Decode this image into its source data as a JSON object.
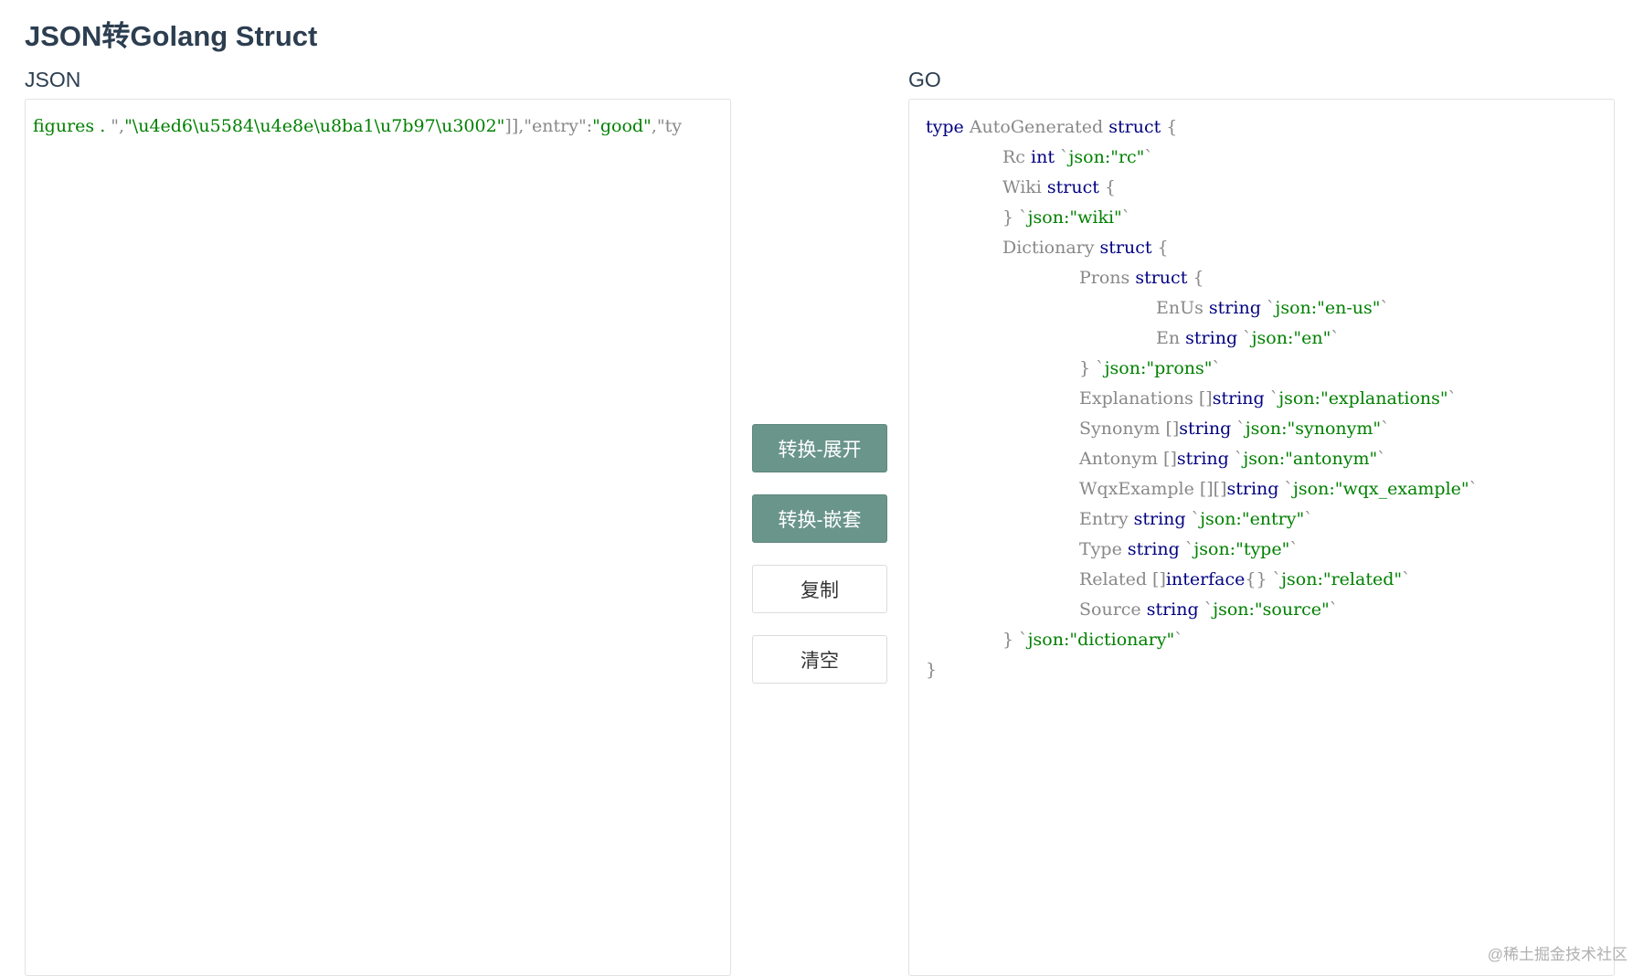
{
  "title": "JSON转Golang Struct",
  "json_label": "JSON",
  "go_label": "GO",
  "json_input": {
    "segments": [
      {
        "text": "figures . ",
        "kind": "str"
      },
      {
        "text": "\",",
        "kind": "p"
      },
      {
        "text": "\"\\u4ed6\\u5584\\u4e8e\\u8ba1\\u7b97\\u3002\"",
        "kind": "str"
      },
      {
        "text": "]],\"entry\":",
        "kind": "p"
      },
      {
        "text": "\"good\"",
        "kind": "str"
      },
      {
        "text": ",\"ty",
        "kind": "p"
      }
    ]
  },
  "buttons": {
    "convert_expand": "转换-展开",
    "convert_nested": "转换-嵌套",
    "copy": "复制",
    "clear": "清空"
  },
  "go_output": [
    {
      "indent": 0,
      "parts": [
        [
          "kw",
          "type"
        ],
        [
          "p",
          " AutoGenerated "
        ],
        [
          "kw",
          "struct"
        ],
        [
          "p",
          " {"
        ]
      ]
    },
    {
      "indent": 1,
      "parts": [
        [
          "p",
          "Rc "
        ],
        [
          "kw",
          "int"
        ],
        [
          "p",
          " `"
        ],
        [
          "str",
          "json:\"rc\""
        ],
        [
          "p",
          "`"
        ]
      ]
    },
    {
      "indent": 1,
      "parts": [
        [
          "p",
          "Wiki "
        ],
        [
          "kw",
          "struct"
        ],
        [
          "p",
          " {"
        ]
      ]
    },
    {
      "indent": 1,
      "parts": [
        [
          "p",
          "} `"
        ],
        [
          "str",
          "json:\"wiki\""
        ],
        [
          "p",
          "`"
        ]
      ]
    },
    {
      "indent": 1,
      "parts": [
        [
          "p",
          "Dictionary "
        ],
        [
          "kw",
          "struct"
        ],
        [
          "p",
          " {"
        ]
      ]
    },
    {
      "indent": 2,
      "parts": [
        [
          "p",
          "Prons "
        ],
        [
          "kw",
          "struct"
        ],
        [
          "p",
          " {"
        ]
      ]
    },
    {
      "indent": 3,
      "parts": [
        [
          "p",
          "EnUs "
        ],
        [
          "kw",
          "string"
        ],
        [
          "p",
          " `"
        ],
        [
          "str",
          "json:\"en-us\""
        ],
        [
          "p",
          "`"
        ]
      ]
    },
    {
      "indent": 3,
      "parts": [
        [
          "p",
          "En "
        ],
        [
          "kw",
          "string"
        ],
        [
          "p",
          " `"
        ],
        [
          "str",
          "json:\"en\""
        ],
        [
          "p",
          "`"
        ]
      ]
    },
    {
      "indent": 2,
      "parts": [
        [
          "p",
          "} `"
        ],
        [
          "str",
          "json:\"prons\""
        ],
        [
          "p",
          "`"
        ]
      ]
    },
    {
      "indent": 2,
      "parts": [
        [
          "p",
          "Explanations []"
        ],
        [
          "kw",
          "string"
        ],
        [
          "p",
          " `"
        ],
        [
          "str",
          "json:\"explanations\""
        ],
        [
          "p",
          "`"
        ]
      ]
    },
    {
      "indent": 2,
      "parts": [
        [
          "p",
          "Synonym []"
        ],
        [
          "kw",
          "string"
        ],
        [
          "p",
          " `"
        ],
        [
          "str",
          "json:\"synonym\""
        ],
        [
          "p",
          "`"
        ]
      ]
    },
    {
      "indent": 2,
      "parts": [
        [
          "p",
          "Antonym []"
        ],
        [
          "kw",
          "string"
        ],
        [
          "p",
          " `"
        ],
        [
          "str",
          "json:\"antonym\""
        ],
        [
          "p",
          "`"
        ]
      ]
    },
    {
      "indent": 2,
      "parts": [
        [
          "p",
          "WqxExample [][]"
        ],
        [
          "kw",
          "string"
        ],
        [
          "p",
          " `"
        ],
        [
          "str",
          "json:\"wqx_example\""
        ],
        [
          "p",
          "`"
        ]
      ]
    },
    {
      "indent": 2,
      "parts": [
        [
          "p",
          "Entry "
        ],
        [
          "kw",
          "string"
        ],
        [
          "p",
          " `"
        ],
        [
          "str",
          "json:\"entry\""
        ],
        [
          "p",
          "`"
        ]
      ]
    },
    {
      "indent": 2,
      "parts": [
        [
          "p",
          "Type "
        ],
        [
          "kw",
          "string"
        ],
        [
          "p",
          " `"
        ],
        [
          "str",
          "json:\"type\""
        ],
        [
          "p",
          "`"
        ]
      ]
    },
    {
      "indent": 2,
      "parts": [
        [
          "p",
          "Related []"
        ],
        [
          "kw",
          "interface"
        ],
        [
          "p",
          "{} `"
        ],
        [
          "str",
          "json:\"related\""
        ],
        [
          "p",
          "`"
        ]
      ]
    },
    {
      "indent": 2,
      "parts": [
        [
          "p",
          "Source "
        ],
        [
          "kw",
          "string"
        ],
        [
          "p",
          " `"
        ],
        [
          "str",
          "json:\"source\""
        ],
        [
          "p",
          "`"
        ]
      ]
    },
    {
      "indent": 1,
      "parts": [
        [
          "p",
          "} `"
        ],
        [
          "str",
          "json:\"dictionary\""
        ],
        [
          "p",
          "`"
        ]
      ]
    },
    {
      "indent": 0,
      "parts": [
        [
          "p",
          "}"
        ]
      ]
    }
  ],
  "watermark": "@稀土掘金技术社区",
  "colors": {
    "primary_button": "#6a958b",
    "keyword": "#000080",
    "string": "#008000",
    "title": "#2c3e50"
  }
}
